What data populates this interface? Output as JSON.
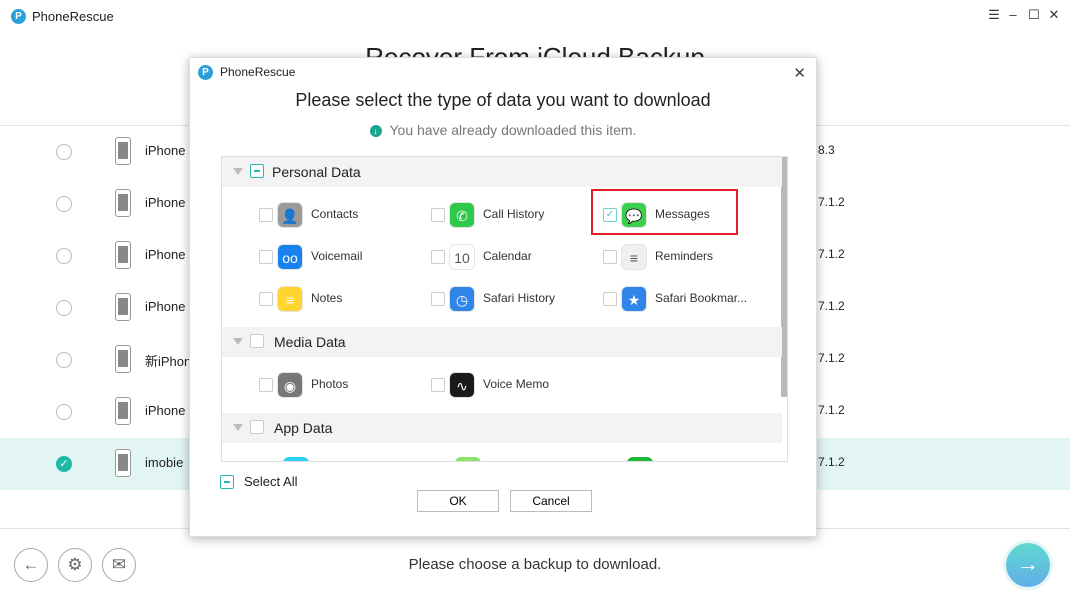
{
  "app": {
    "title": "PhoneRescue",
    "logo": "P",
    "page_title": "Recover From iCloud Backup"
  },
  "window_controls": {
    "menu": "☰",
    "minimize": "–",
    "maximize": "☐",
    "close": "✕"
  },
  "backups": [
    {
      "name": "iPhone",
      "version": "8.3",
      "selected": false
    },
    {
      "name": "iPhone",
      "version": "7.1.2",
      "selected": false
    },
    {
      "name": "iPhone",
      "version": "7.1.2",
      "selected": false
    },
    {
      "name": "iPhone",
      "version": "7.1.2",
      "selected": false
    },
    {
      "name": "新iPhone",
      "version": "7.1.2",
      "selected": false
    },
    {
      "name": "iPhone",
      "version": "7.1.2",
      "selected": false
    },
    {
      "name": "imobie",
      "version": "7.1.2",
      "selected": true
    }
  ],
  "footer": {
    "status": "Please choose a backup to download.",
    "back": "←",
    "settings": "⚙",
    "mail": "✉",
    "next": "→"
  },
  "dialog": {
    "title": "PhoneRescue",
    "close": "✕",
    "heading": "Please select the type of data you want to download",
    "note": "You have already downloaded this item.",
    "groups": [
      {
        "label": "Personal Data",
        "state": "partial",
        "items": [
          {
            "label": "Contacts",
            "checked": false,
            "icon": "contacts-icon",
            "glyph": "👤",
            "color": "#9a9a9a"
          },
          {
            "label": "Call History",
            "checked": false,
            "icon": "phone-icon",
            "glyph": "✆",
            "color": "#2ec84a"
          },
          {
            "label": "Messages",
            "checked": true,
            "icon": "messages-icon",
            "glyph": "💬",
            "color": "#3ccf4e"
          },
          {
            "label": "Voicemail",
            "checked": false,
            "icon": "voicemail-icon",
            "glyph": "oo",
            "color": "#1a82f0"
          },
          {
            "label": "Calendar",
            "checked": false,
            "icon": "calendar-icon",
            "glyph": "10",
            "color": "#ffffff"
          },
          {
            "label": "Reminders",
            "checked": false,
            "icon": "reminders-icon",
            "glyph": "≡",
            "color": "#f0f0f0"
          },
          {
            "label": "Notes",
            "checked": false,
            "icon": "notes-icon",
            "glyph": "≡",
            "color": "#ffd52e"
          },
          {
            "label": "Safari History",
            "checked": false,
            "icon": "safari-history-icon",
            "glyph": "◷",
            "color": "#2f86e8"
          },
          {
            "label": "Safari Bookmar...",
            "checked": false,
            "icon": "safari-bookmark-icon",
            "glyph": "★",
            "color": "#2f86e8"
          }
        ]
      },
      {
        "label": "Media Data",
        "state": "unchecked",
        "items": [
          {
            "label": "Photos",
            "checked": false,
            "icon": "camera-icon",
            "glyph": "◉",
            "color": "#777777"
          },
          {
            "label": "Voice Memo",
            "checked": false,
            "icon": "voice-memo-icon",
            "glyph": "∿",
            "color": "#1a1a1a"
          }
        ]
      },
      {
        "label": "App Data",
        "state": "unchecked"
      }
    ],
    "select_all": "Select All",
    "ok": "OK",
    "cancel": "Cancel"
  },
  "colors": {
    "accent": "#1fb9a5",
    "highlight": "#e32029",
    "selected_row": "#e2f5f3"
  }
}
